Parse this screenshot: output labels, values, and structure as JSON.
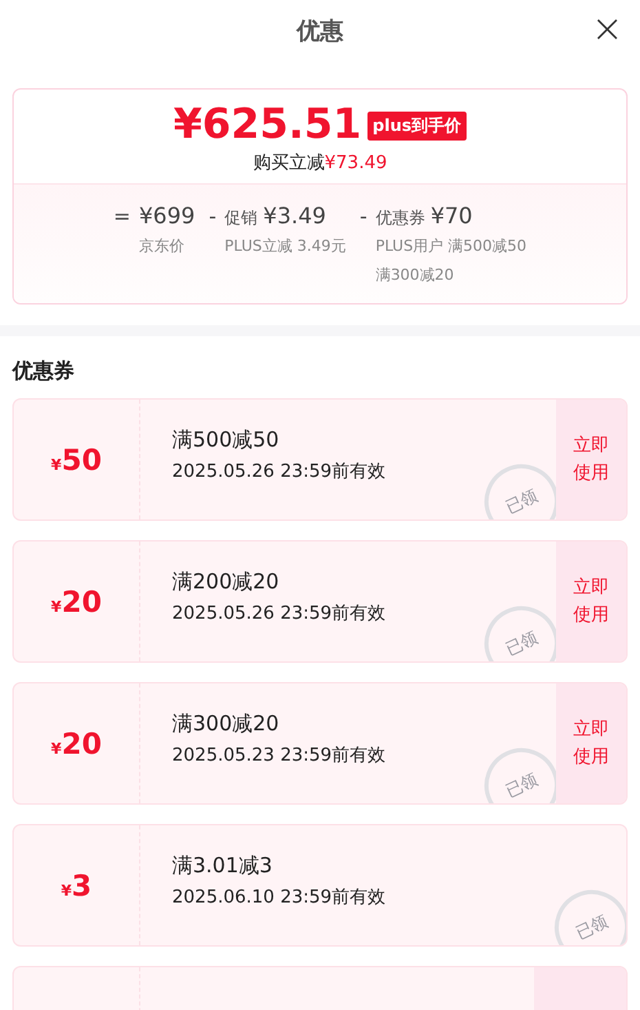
{
  "header": {
    "title": "优惠",
    "close": "×"
  },
  "summary": {
    "price": "¥625.51",
    "badge": "plus到手价",
    "saving_label": "购买立减",
    "saving_amount": "¥73.49",
    "breakdown": [
      {
        "op": "=",
        "amount": "¥699",
        "notes": [
          "京东价"
        ]
      },
      {
        "op": "-",
        "label": "促销",
        "amount": "¥3.49",
        "notes": [
          "PLUS立减 3.49元"
        ]
      },
      {
        "op": "-",
        "label": "优惠券",
        "amount": "¥70",
        "notes": [
          "PLUS用户 满500减50",
          "满300减20"
        ]
      }
    ]
  },
  "coupons_title": "优惠券",
  "coupons": [
    {
      "currency": "¥",
      "value": "50",
      "condition": "满500减50",
      "validity": "2025.05.26 23:59前有效",
      "action": "立即使用",
      "stamp": "已领"
    },
    {
      "currency": "¥",
      "value": "20",
      "condition": "满200减20",
      "validity": "2025.05.26 23:59前有效",
      "action": "立即使用",
      "stamp": "已领"
    },
    {
      "currency": "¥",
      "value": "20",
      "condition": "满300减20",
      "validity": "2025.05.23 23:59前有效",
      "action": "立即使用",
      "stamp": "已领"
    },
    {
      "currency": "¥",
      "value": "3",
      "condition": "满3.01减3",
      "validity": "2025.06.10 23:59前有效",
      "stamp": "已领"
    },
    {
      "action_panel": true
    }
  ]
}
